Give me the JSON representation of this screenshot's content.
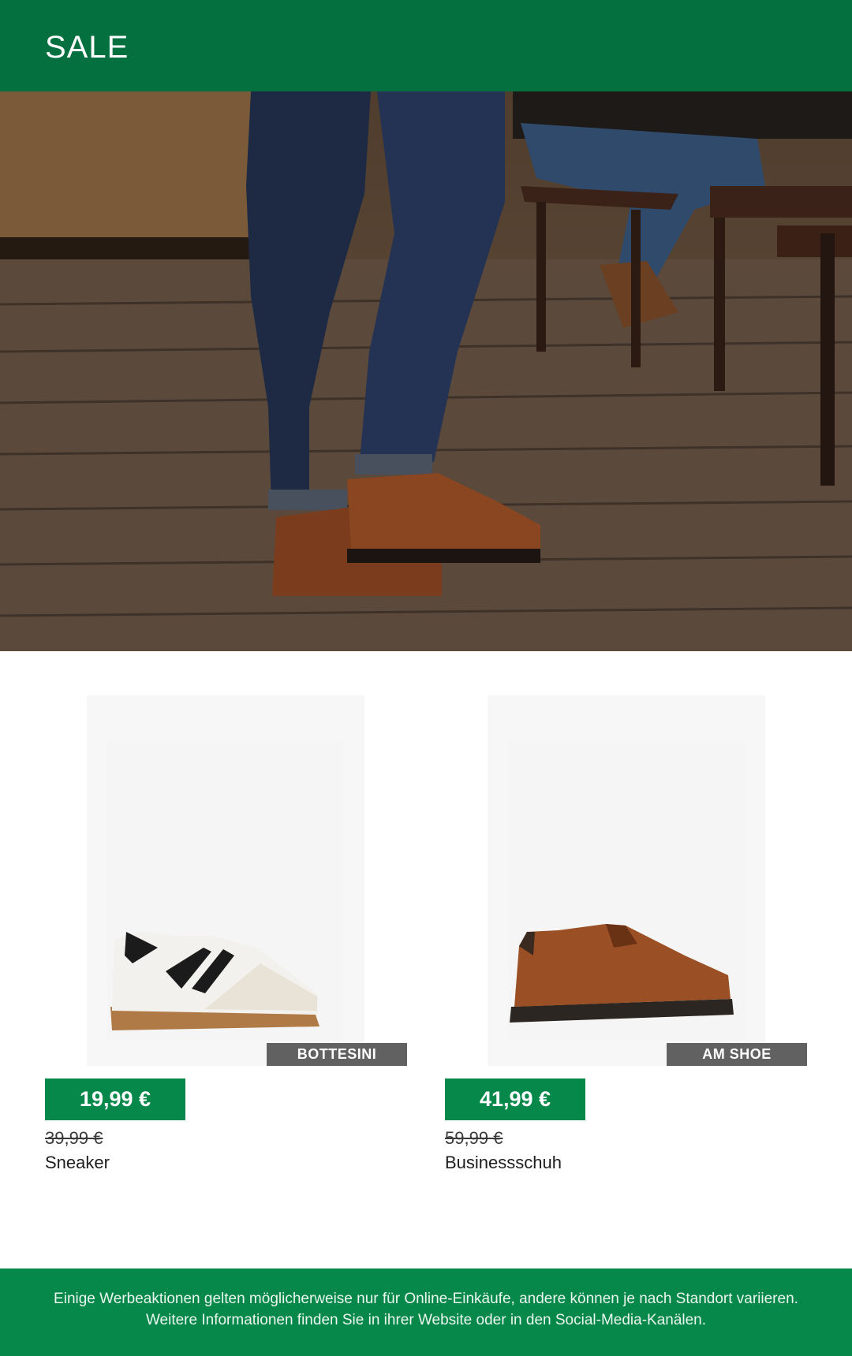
{
  "header": {
    "title": "SALE"
  },
  "hero": {
    "image": "man-in-jeans-brown-shoes-photo"
  },
  "products": [
    {
      "brand": "BOTTESINI",
      "price": "19,99 €",
      "old_price": "39,99 €",
      "name": "Sneaker",
      "image": "white-sneaker-black-stripes"
    },
    {
      "brand": "AM SHOE",
      "price": "41,99 €",
      "old_price": "59,99 €",
      "name": "Businessschuh",
      "image": "brown-derby-shoe"
    }
  ],
  "footer": {
    "disclaimer": "Einige Werbeaktionen gelten möglicherweise nur für Online-Einkäufe, andere können je nach Standort variieren. Weitere Informationen finden Sie in ihrer Website oder in den Social-Media-Kanälen."
  },
  "colors": {
    "brand_green": "#04703f",
    "price_green": "#06884a",
    "tag_gray": "#616161"
  }
}
